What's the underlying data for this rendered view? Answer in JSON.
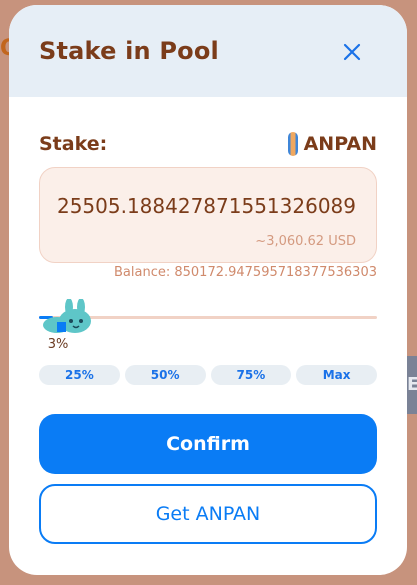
{
  "backdrop": {
    "left_text": "Q",
    "right_text": "E"
  },
  "modal": {
    "title": "Stake in Pool",
    "close_icon": "close-icon"
  },
  "stake": {
    "label": "Stake:",
    "token_name": "ANPAN",
    "token_icon": "anpan-token-icon"
  },
  "amount": {
    "value": "25505.188427871551326089",
    "usd": "~3,060.62 USD"
  },
  "balance": {
    "text": "Balance: 850172.947595718377536303"
  },
  "slider": {
    "percent_value": 3,
    "percent_label": "3%",
    "thumb_icon": "bunny-mascot-icon"
  },
  "percent_buttons": [
    "25%",
    "50%",
    "75%",
    "Max"
  ],
  "actions": {
    "confirm_label": "Confirm",
    "get_label": "Get ANPAN"
  },
  "colors": {
    "accent": "#0a7cf5",
    "title_brown": "#7b3c1a",
    "input_bg": "#fbefe9",
    "header_bg": "#e6eef6",
    "backdrop": "#c7937d"
  }
}
